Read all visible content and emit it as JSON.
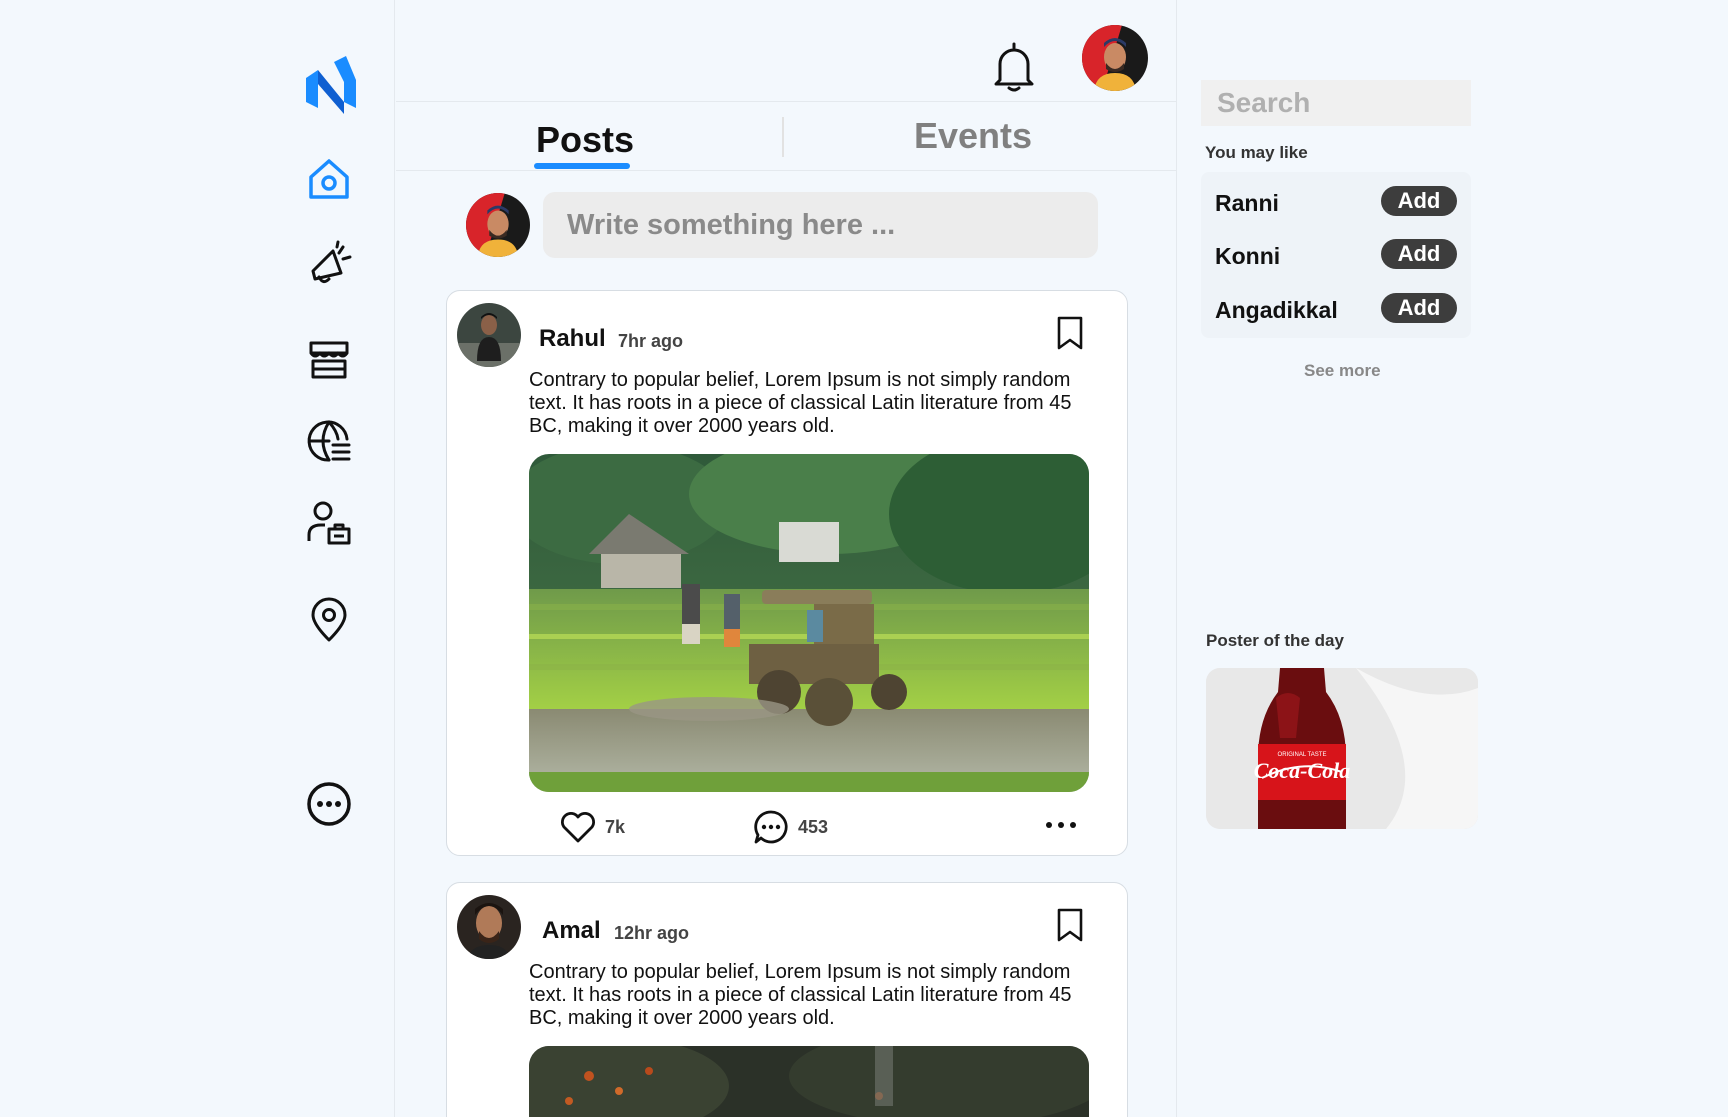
{
  "nav": {
    "logo": "n-logo-icon",
    "items": [
      "home-icon",
      "megaphone-icon",
      "store-icon",
      "globe-icon",
      "user-badge-icon",
      "location-pin-icon",
      "more-circle-icon"
    ],
    "active_color": "#1a8cff"
  },
  "header": {
    "notification_icon": "bell-icon",
    "avatar": "user-avatar"
  },
  "tabs": [
    {
      "label": "Posts",
      "active": true
    },
    {
      "label": "Events",
      "active": false
    }
  ],
  "composer": {
    "placeholder": "Write something here ..."
  },
  "posts": [
    {
      "author": "Rahul",
      "time": "7hr ago",
      "text": "Contrary to popular belief, Lorem Ipsum is not simply random text. It has roots in a piece of classical Latin literature from 45 BC, making it over 2000 years old.",
      "image": "tractor-in-rice-field-photo",
      "likes": "7k",
      "comments": "453"
    },
    {
      "author": "Amal",
      "time": "12hr ago",
      "text": "Contrary to popular belief, Lorem Ipsum is not simply random text. It has roots in a piece of classical Latin literature from 45 BC, making it over 2000 years old.",
      "image": "dark-foliage-photo"
    }
  ],
  "right": {
    "search_placeholder": "Search",
    "you_may_like_title": "You may like",
    "suggestions": [
      {
        "name": "Ranni",
        "action": "Add"
      },
      {
        "name": "Konni",
        "action": "Add"
      },
      {
        "name": "Angadikkal",
        "action": "Add"
      }
    ],
    "see_more": "See more",
    "poster_title": "Poster of the day",
    "poster_image": "coca-cola-bottle-photo"
  }
}
